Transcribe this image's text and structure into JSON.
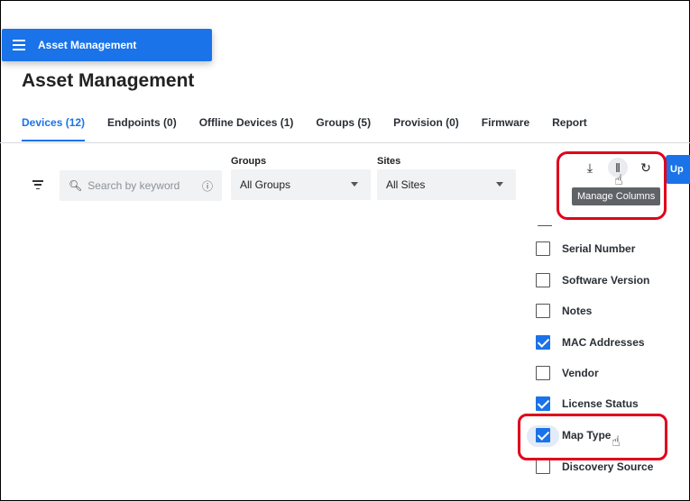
{
  "nav": {
    "label": "Asset Management",
    "icon": "list-icon"
  },
  "page": {
    "title": "Asset Management"
  },
  "tabs": [
    {
      "label": "Devices (12)"
    },
    {
      "label": "Endpoints (0)"
    },
    {
      "label": "Offline Devices (1)"
    },
    {
      "label": "Groups (5)"
    },
    {
      "label": "Provision (0)"
    },
    {
      "label": "Firmware"
    },
    {
      "label": "Report"
    }
  ],
  "search": {
    "placeholder": "Search by keyword"
  },
  "filters": {
    "groups_label": "Groups",
    "groups_value": "All Groups",
    "sites_label": "Sites",
    "sites_value": "All Sites"
  },
  "toolbar": {
    "download_icon": "⤓",
    "columns_icon": "‖",
    "refresh_icon": "↻",
    "tooltip": "Manage Columns",
    "blue_button_partial": "Up"
  },
  "columns": [
    {
      "label": "Serial Number",
      "checked": false
    },
    {
      "label": "Software Version",
      "checked": false
    },
    {
      "label": "Notes",
      "checked": false
    },
    {
      "label": "MAC Addresses",
      "checked": true
    },
    {
      "label": "Vendor",
      "checked": false
    },
    {
      "label": "License Status",
      "checked": true
    },
    {
      "label": "Map Type",
      "checked": true
    },
    {
      "label": "Discovery Source",
      "checked": false
    }
  ],
  "colors": {
    "accent": "#1a73e8",
    "highlight": "#e0001b"
  }
}
